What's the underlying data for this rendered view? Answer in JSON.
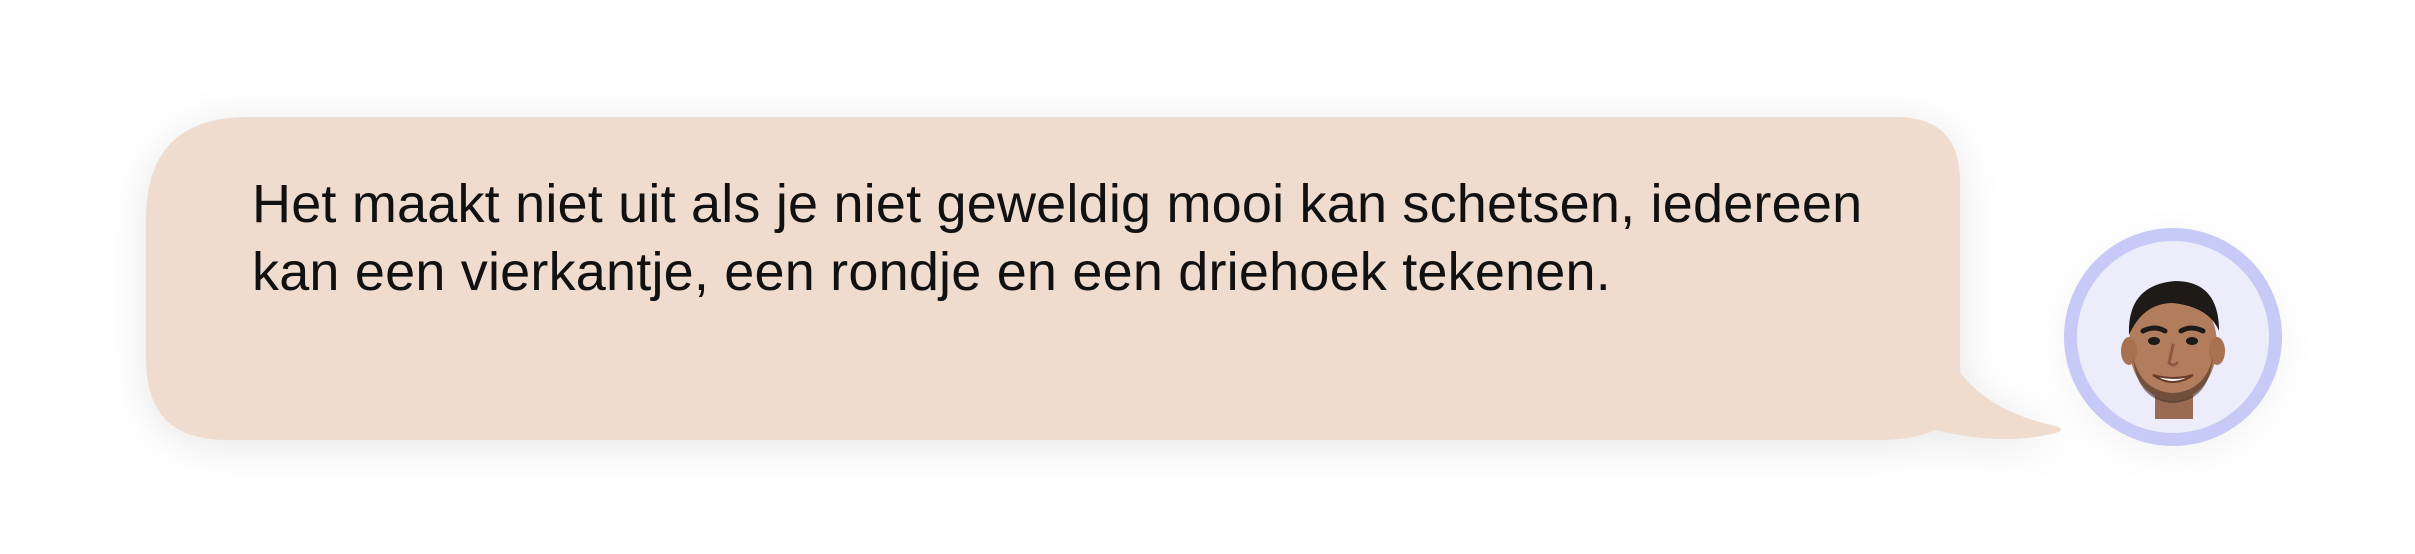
{
  "message": {
    "text": "Het maakt niet uit als je niet geweldig mooi kan schetsen, iedereen kan een vierkantje, een rondje en een driehoek tekenen."
  },
  "avatar": {
    "icon": "person-face-icon"
  },
  "colors": {
    "bubble": "#efdccf",
    "avatar_ring": "#c7c9f6",
    "avatar_fill": "#ececfb",
    "text": "#111111"
  }
}
